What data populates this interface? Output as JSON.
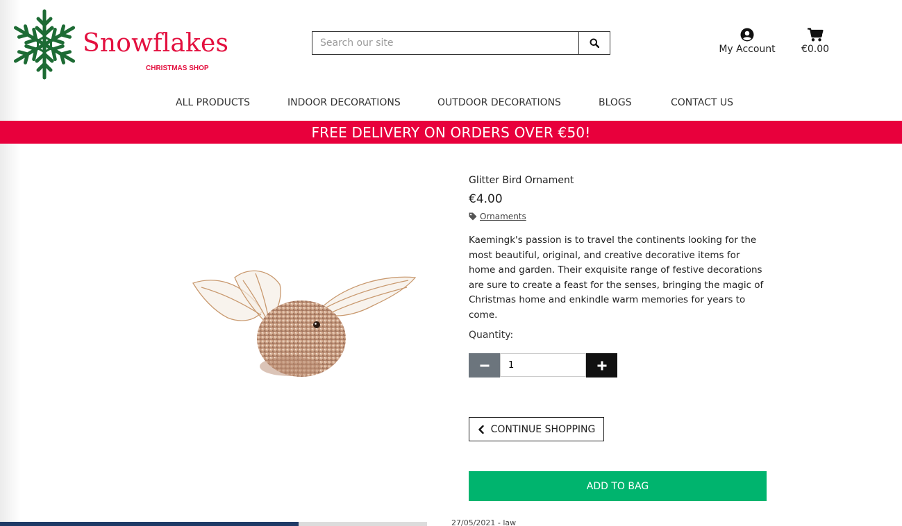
{
  "brand": {
    "name": "Snowflakes",
    "tagline": "CHRISTMAS SHOP",
    "logo_icon": "snowflake-icon",
    "color": "#e3103f",
    "snowflake_color": "#1d6b34"
  },
  "search": {
    "placeholder": "Search our site",
    "value": ""
  },
  "header": {
    "account_label": "My Account",
    "cart_total": "€0.00"
  },
  "nav": {
    "items": [
      "ALL PRODUCTS",
      "INDOOR DECORATIONS",
      "OUTDOOR DECORATIONS",
      "BLOGS",
      "CONTACT US"
    ]
  },
  "banner": {
    "text": "FREE DELIVERY ON ORDERS OVER €50!",
    "color": "#e8003c"
  },
  "product": {
    "name": "Glitter Bird Ornament",
    "price": "€4.00",
    "category": "Ornaments",
    "description": "Kaemingk's passion is to travel the continents looking for the most beautiful, original, and creative decorative items for home and garden. Their exquisite range of festive decorations are sure to create a feast for the senses, bringing the magic of Christmas home and enkindle warm memories for years to come.",
    "quantity_label": "Quantity:",
    "quantity": "1",
    "continue_label": "CONTINUE SHOPPING",
    "add_label": "ADD TO BAG",
    "add_color": "#00b46e"
  },
  "background_window": {
    "partial_text": "27/05/2021 - law"
  }
}
